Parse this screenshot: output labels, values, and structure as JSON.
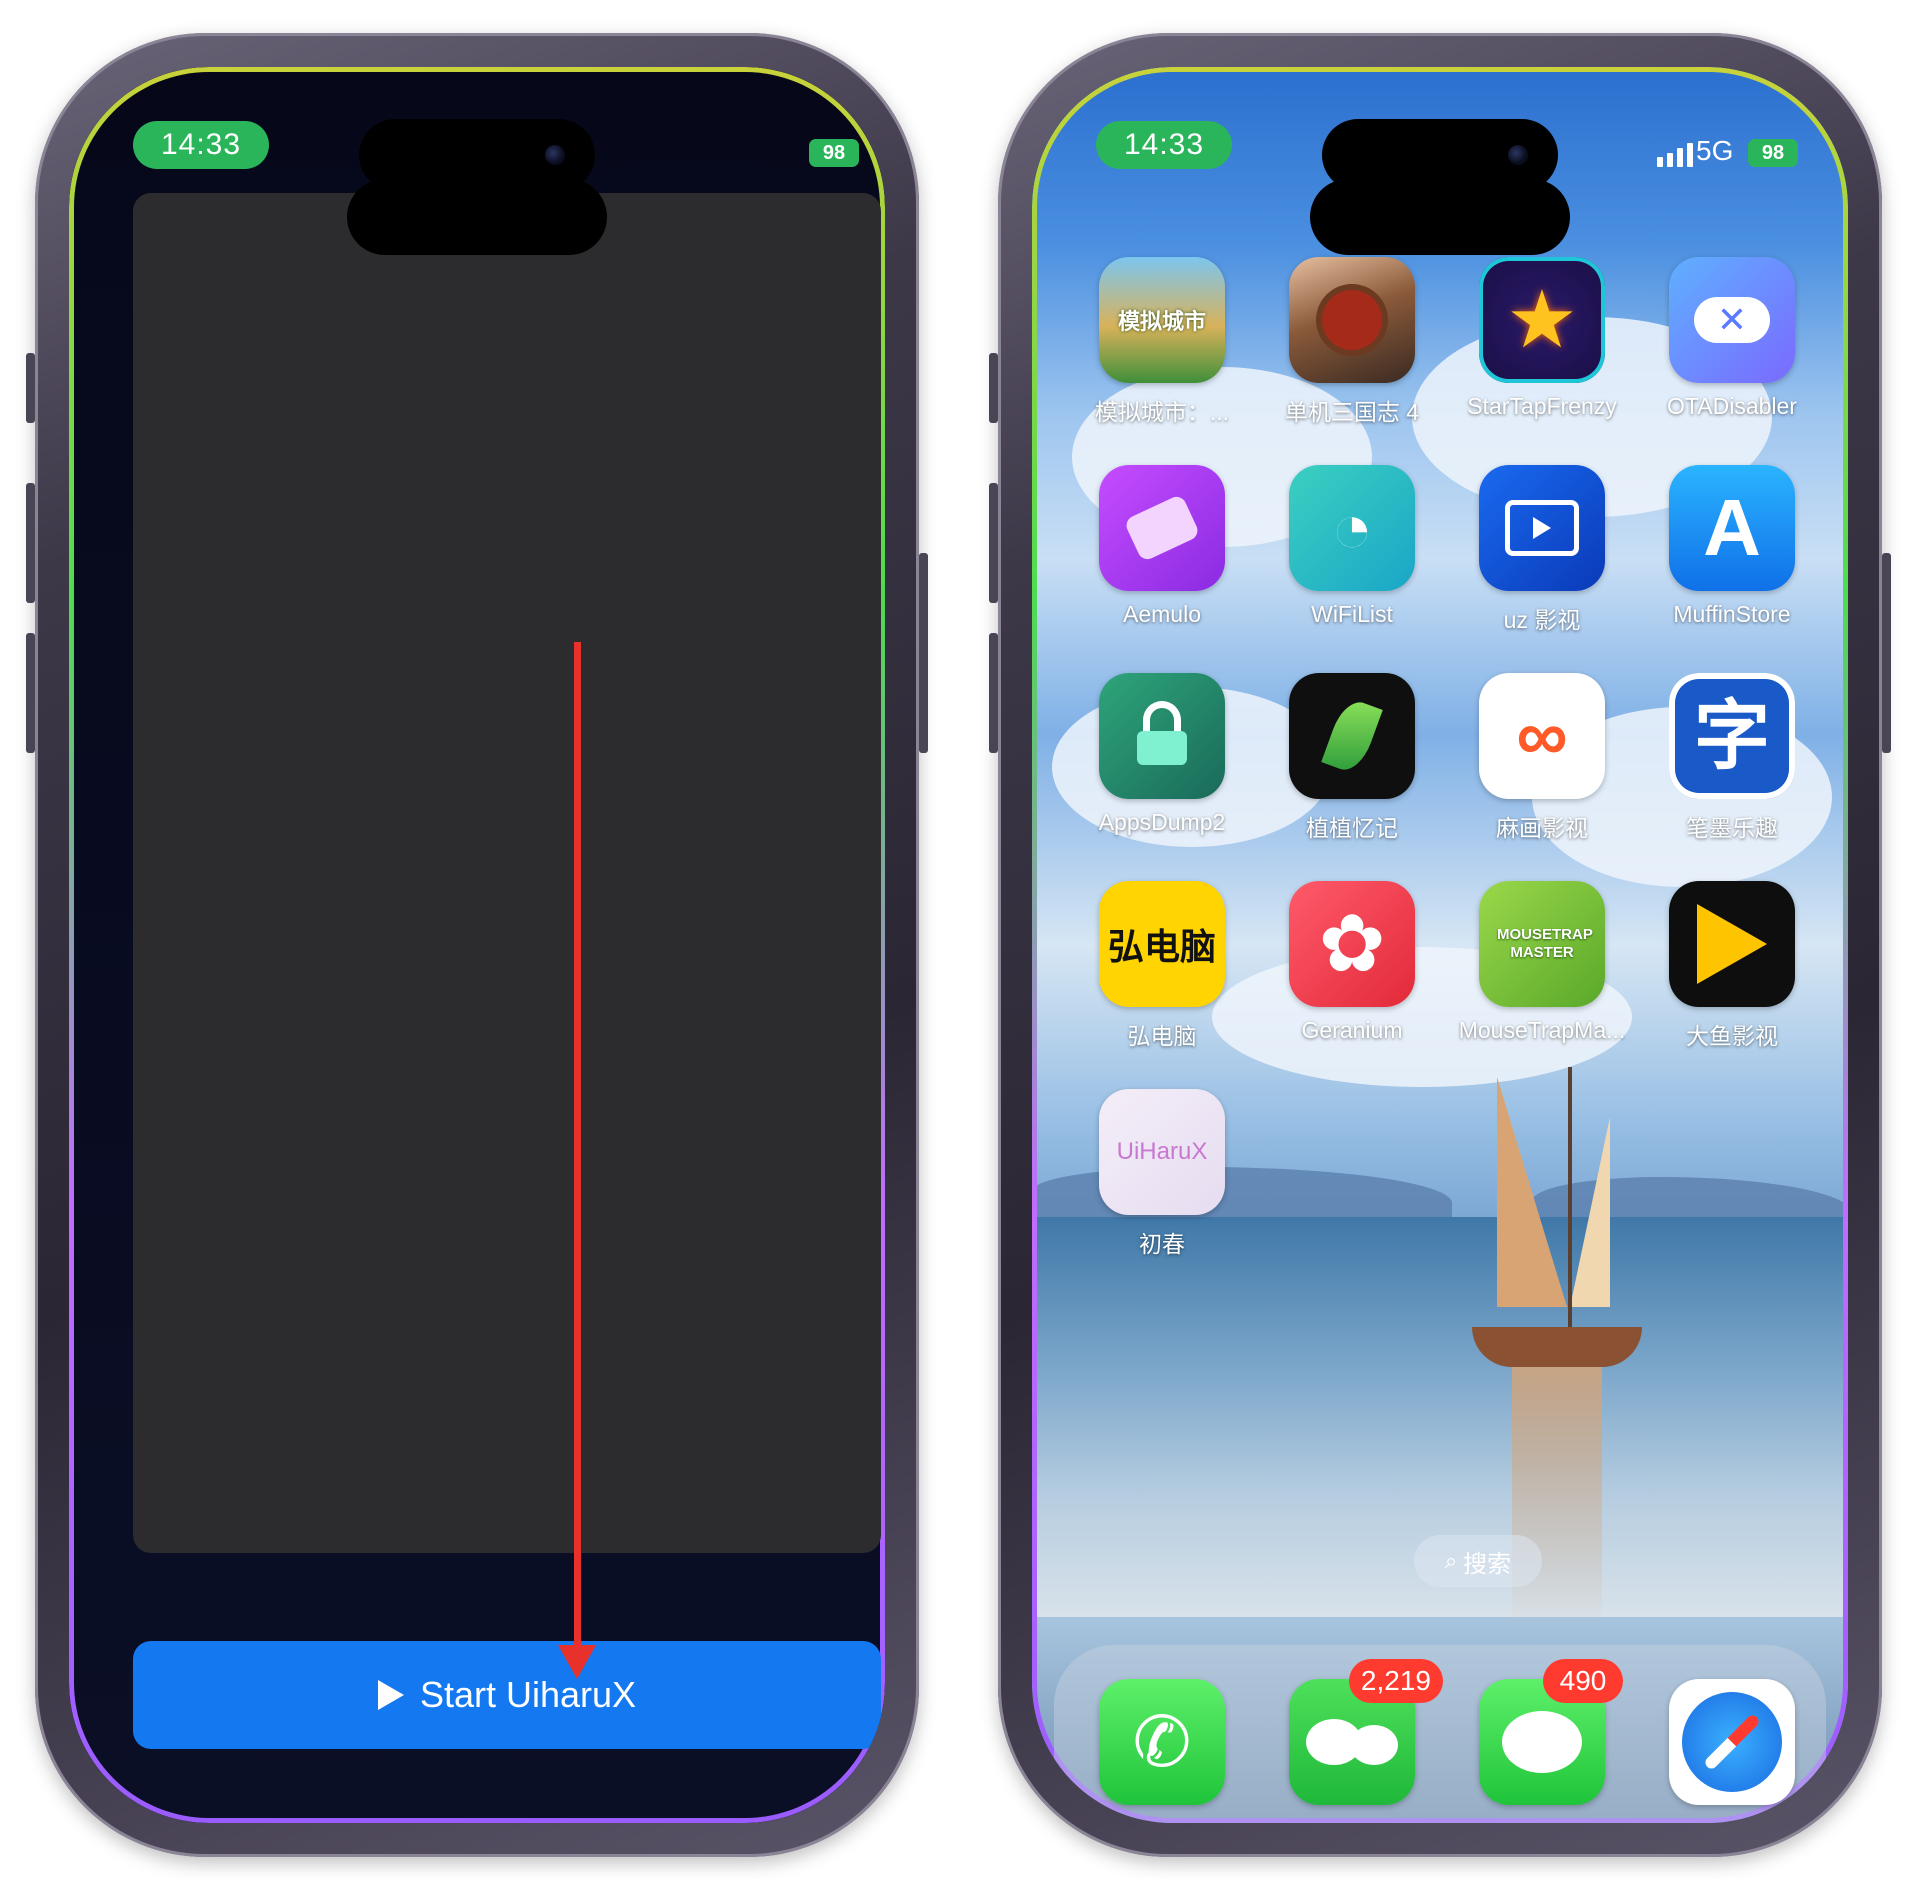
{
  "left_phone": {
    "status_time": "14:33",
    "battery": "98",
    "start_button_label": "Start UiharuX"
  },
  "right_phone": {
    "status_time": "14:33",
    "network": "5G",
    "battery": "98",
    "apps": [
      {
        "label": "模拟城市：...",
        "icon": "simcity-icon",
        "icon_text": "模拟城市"
      },
      {
        "label": "单机三国志 4",
        "icon": "three-kingdoms-icon"
      },
      {
        "label": "StarTapFrenzy",
        "icon": "star-tap-icon"
      },
      {
        "label": "OTADisabler",
        "icon": "ota-disabler-cloud-icon"
      },
      {
        "label": "Aemulo",
        "icon": "aemulo-icon"
      },
      {
        "label": "WiFiList",
        "icon": "wifi-list-icon"
      },
      {
        "label": "uz 影视",
        "icon": "uz-tv-icon"
      },
      {
        "label": "MuffinStore",
        "icon": "muffin-store-icon"
      },
      {
        "label": "AppsDump2",
        "icon": "apps-dump-lock-icon"
      },
      {
        "label": "植植忆记",
        "icon": "plant-leaf-icon"
      },
      {
        "label": "麻画影视",
        "icon": "mahua-video-icon"
      },
      {
        "label": "笔墨乐趣",
        "icon": "ink-char-icon",
        "icon_text": "字"
      },
      {
        "label": "弘电脑",
        "icon": "hong-computer-icon",
        "icon_text": "弘电脑"
      },
      {
        "label": "Geranium",
        "icon": "geranium-flower-icon"
      },
      {
        "label": "MouseTrapMa...",
        "icon": "mousetrap-icon",
        "icon_text": "MOUSETRAP MASTER"
      },
      {
        "label": "大鱼影视",
        "icon": "big-fish-icon"
      },
      {
        "label": "初春",
        "icon": "uiharux-icon",
        "icon_text": "UiHaruX"
      }
    ],
    "search_label": "搜索",
    "dock": [
      {
        "name": "phone",
        "icon": "phone-icon",
        "badge": ""
      },
      {
        "name": "wechat",
        "icon": "wechat-icon",
        "badge": "2,219"
      },
      {
        "name": "messages",
        "icon": "messages-icon",
        "badge": "490"
      },
      {
        "name": "safari",
        "icon": "safari-compass-icon",
        "badge": ""
      }
    ]
  }
}
